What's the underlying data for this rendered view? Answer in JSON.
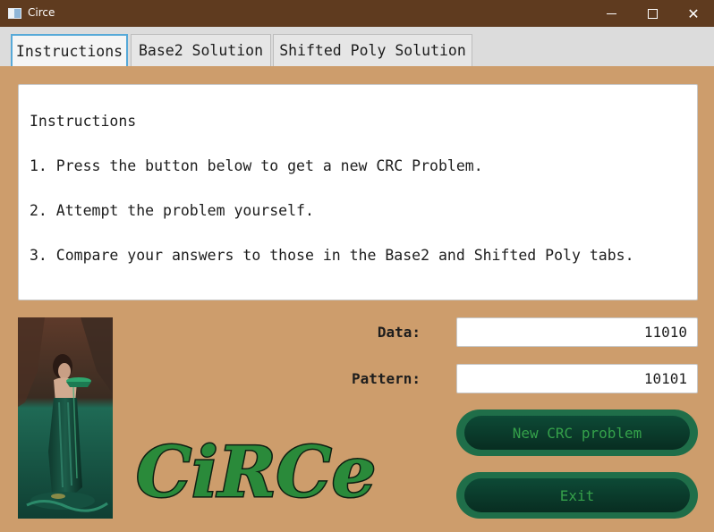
{
  "window": {
    "title": "Circe",
    "minimize_glyph": "",
    "maximize_glyph": "",
    "close_glyph": "✕"
  },
  "tabs": [
    {
      "label": "Instructions",
      "active": true
    },
    {
      "label": "Base2 Solution",
      "active": false
    },
    {
      "label": "Shifted Poly Solution",
      "active": false
    }
  ],
  "instructions": {
    "heading": "Instructions",
    "steps": [
      "1. Press the button below to get a new CRC Problem.",
      "2. Attempt the problem yourself.",
      "3. Compare your answers to those in the Base2 and Shifted Poly tabs."
    ]
  },
  "form": {
    "data_label": "Data:",
    "data_value": "11010",
    "pattern_label": "Pattern:",
    "pattern_value": "10101"
  },
  "buttons": {
    "new_problem": "New CRC problem",
    "exit": "Exit"
  },
  "logo": {
    "text": "CiRCe",
    "fill_color": "#2a8a3a",
    "outline_color": "#0e1f12"
  },
  "colors": {
    "background": "#cd9d6c",
    "titlebar": "#5f3b1f",
    "button_ring": "#1f6e49",
    "button_text": "#35a14a",
    "active_tab_border": "#57a9d8"
  },
  "icons": {
    "app": "window-app-icon",
    "minimize": "minimize-icon",
    "maximize": "maximize-icon",
    "close": "close-icon"
  }
}
